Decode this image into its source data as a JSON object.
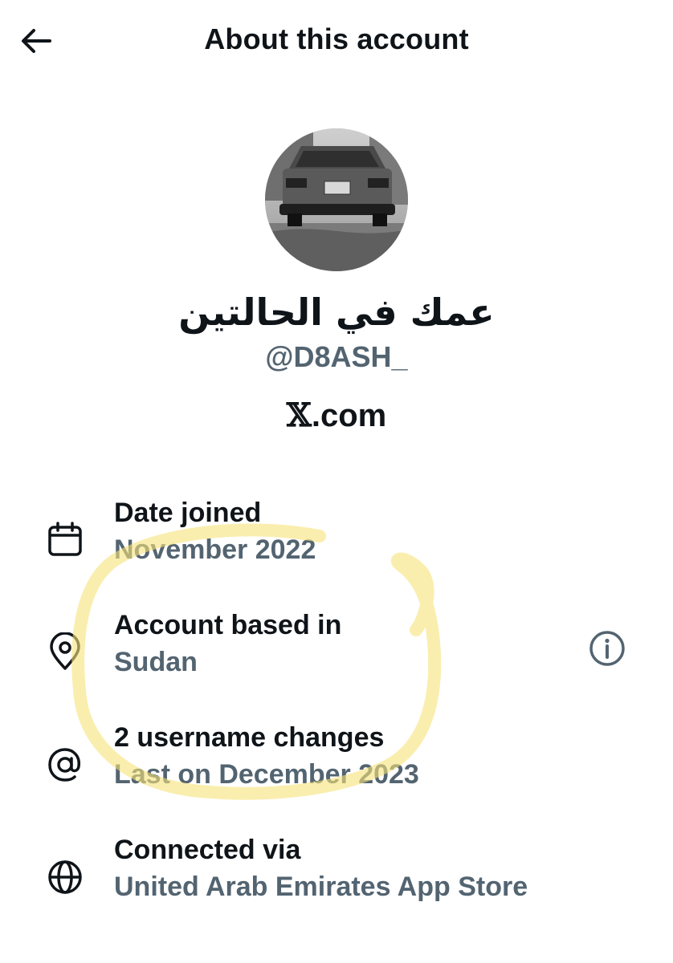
{
  "header": {
    "title": "About this account",
    "back_icon": "arrow-left-icon"
  },
  "profile": {
    "display_name": "عمك في الحالتين",
    "handle": "@D8ASH_",
    "verified_via_mark": "𝕏",
    "verified_via_suffix": ".com"
  },
  "details": [
    {
      "icon": "calendar-icon",
      "title": "Date joined",
      "value": "November 2022"
    },
    {
      "icon": "location-pin-icon",
      "title": "Account based in",
      "value": "Sudan",
      "action_icon": "info-icon"
    },
    {
      "icon": "at-sign-icon",
      "title": "2 username changes",
      "value": "Last on December 2023"
    },
    {
      "icon": "globe-icon",
      "title": "Connected via",
      "value": "United Arab Emirates App Store"
    }
  ],
  "colors": {
    "primary_text": "#0f1419",
    "secondary_text": "#536471",
    "highlight_marker": "#f7e27a",
    "background": "#ffffff"
  }
}
